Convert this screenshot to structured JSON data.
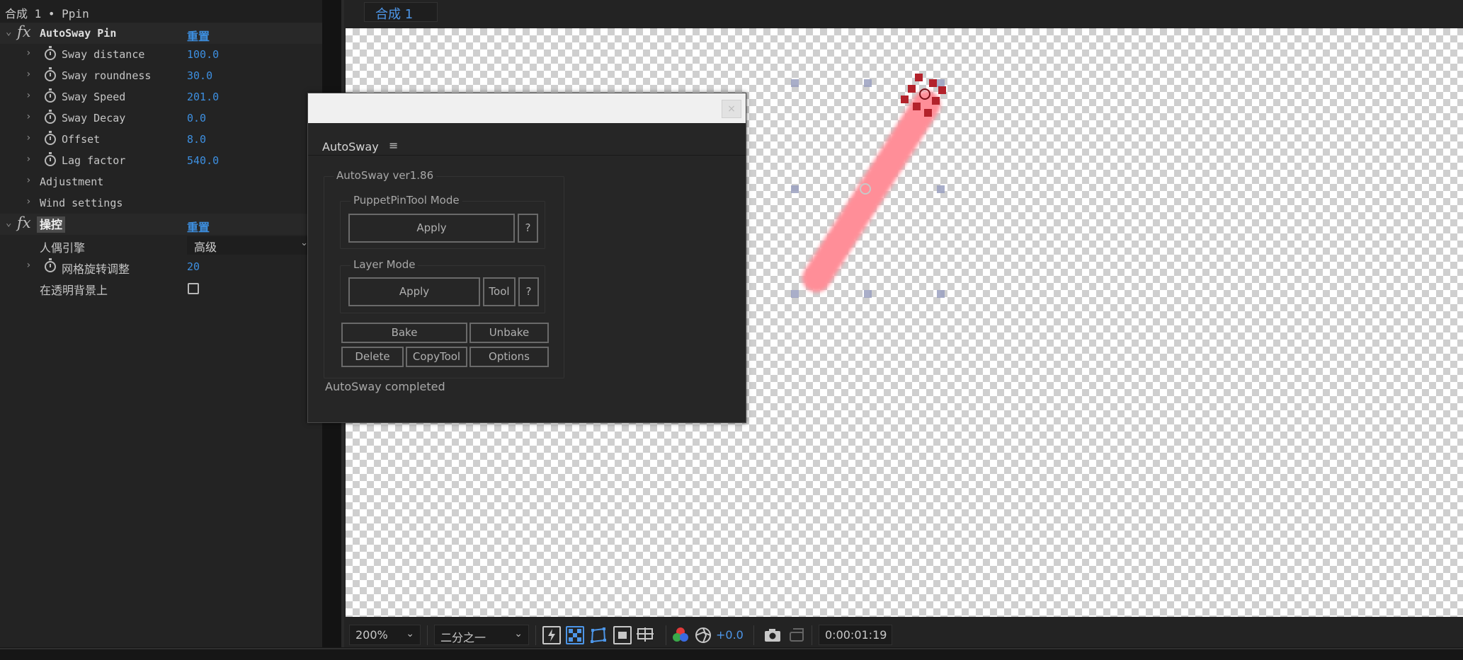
{
  "effect_controls": {
    "header": "合成 1 • Ppin",
    "autosway": {
      "name": "AutoSway Pin",
      "reset": "重置",
      "params": [
        {
          "label": "Sway distance",
          "value": "100.0"
        },
        {
          "label": "Sway roundness",
          "value": "30.0"
        },
        {
          "label": "Sway Speed",
          "value": "201.0"
        },
        {
          "label": "Sway Decay",
          "value": "0.0"
        },
        {
          "label": "Offset",
          "value": "8.0"
        },
        {
          "label": "Lag factor",
          "value": "540.0"
        }
      ],
      "groups": [
        "Adjustment",
        "Wind settings"
      ]
    },
    "puppet": {
      "name": "操控",
      "reset": "重置",
      "engine_label": "人偶引擎",
      "engine_value": "高级",
      "mesh_label": "网格旋转调整",
      "mesh_value": "20",
      "transparent_label": "在透明背景上"
    }
  },
  "composition": {
    "tab": "合成 1",
    "zoom": "200%",
    "resolution": "二分之一",
    "exposure": "+0.0",
    "timecode": "0:00:01:19"
  },
  "autosway_window": {
    "panel_title": "AutoSway",
    "menu_icon": "hamburger-icon",
    "close_icon": "×",
    "version": "AutoSway ver1.86",
    "puppet_mode": {
      "title": "PuppetPinTool Mode",
      "apply": "Apply",
      "help": "?"
    },
    "layer_mode": {
      "title": "Layer Mode",
      "apply": "Apply",
      "tool": "Tool",
      "help": "?"
    },
    "buttons": {
      "bake": "Bake",
      "unbake": "Unbake",
      "delete": "Delete",
      "copytool": "CopyTool",
      "options": "Options"
    },
    "status": "AutoSway completed"
  },
  "colors": {
    "accent_blue": "#3d8fe0",
    "stroke_pink": "#ff8e98",
    "pin_red": "#b3222b"
  }
}
